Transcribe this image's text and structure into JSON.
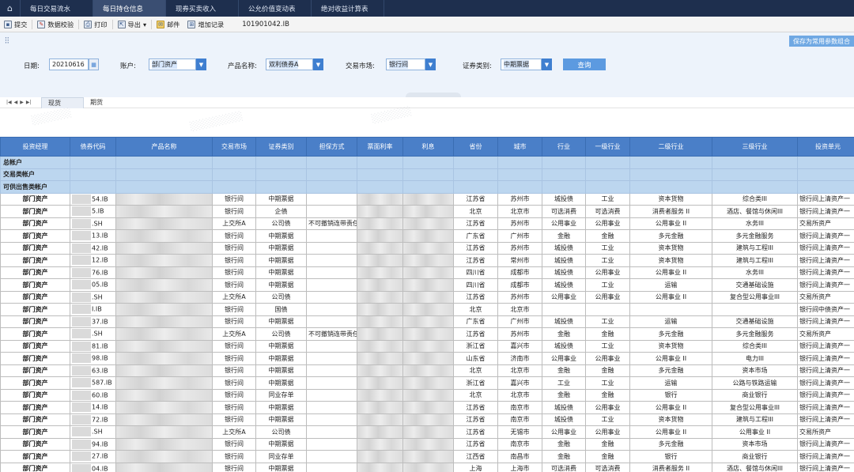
{
  "top_tabs": {
    "home_icon": "home-icon",
    "items": [
      {
        "label": "每日交易流水",
        "active": false
      },
      {
        "label": "每日持仓信息",
        "active": true
      },
      {
        "label": "现券买卖收入",
        "active": false
      },
      {
        "label": "公允价值变动表",
        "active": false
      },
      {
        "label": "绝对收益计算表",
        "active": false
      }
    ]
  },
  "toolbar": {
    "submit": "提交",
    "validate": "数据校验",
    "print": "打印",
    "export": "导出",
    "export_arrow": "▾",
    "mail": "邮件",
    "add_record": "增加记录",
    "code": "101901042.IB"
  },
  "filters": {
    "save_params": "保存为常用参数组合",
    "date_label": "日期:",
    "date_value": "20210616",
    "account_label": "账户:",
    "account_value": "部门资产",
    "product_label": "产品名称:",
    "product_value": "双利债券A",
    "market_label": "交易市场:",
    "market_value": "银行间",
    "category_label": "证券类别:",
    "category_value": "中期票据",
    "query": "查询"
  },
  "sheet_tabs": {
    "nav": [
      "|◀",
      "◀",
      "▶",
      "▶|"
    ],
    "items": [
      {
        "label": "现货",
        "active": true
      },
      {
        "label": "期货",
        "active": false
      }
    ]
  },
  "table": {
    "columns": [
      "投资经理",
      "债券代码",
      "产品名称",
      "交易市场",
      "证券类别",
      "担保方式",
      "票面利率",
      "利息",
      "省份",
      "城市",
      "行业",
      "一级行业",
      "二级行业",
      "三级行业",
      "投资单元"
    ],
    "groups": [
      "总帐户",
      "交易类帐户",
      "可供出售类帐户"
    ],
    "rows": [
      [
        "部门资产",
        "54.IB",
        "",
        "银行间",
        "中期票据",
        "",
        "",
        "",
        "江苏省",
        "苏州市",
        "城投债",
        "工业",
        "资本货物",
        "综合类III",
        "银行间上清资产一"
      ],
      [
        "部门资产",
        "5.IB",
        "",
        "银行间",
        "企债",
        "",
        "",
        "",
        "北京",
        "北京市",
        "可选消费",
        "可选消费",
        "消费者服务 II",
        "酒店、餐馆与休闲III",
        "银行间上清资产一"
      ],
      [
        "部门资产",
        ".SH",
        "",
        "上交所A",
        "公司债",
        "不可撤销连带责任担保",
        "",
        "",
        "江苏省",
        "苏州市",
        "公用事业",
        "公用事业",
        "公用事业 II",
        "水务III",
        "交易所资产"
      ],
      [
        "部门资产",
        "13.IB",
        "",
        "银行间",
        "中期票据",
        "",
        "",
        "",
        "广东省",
        "广州市",
        "金融",
        "金融",
        "多元金融",
        "多元金融服务",
        "银行间上清资产一"
      ],
      [
        "部门资产",
        "42.IB",
        "",
        "银行间",
        "中期票据",
        "",
        "",
        "",
        "江苏省",
        "苏州市",
        "城投债",
        "工业",
        "资本货物",
        "建筑与工程III",
        "银行间上清资产一"
      ],
      [
        "部门资产",
        "12.IB",
        "",
        "银行间",
        "中期票据",
        "",
        "",
        "",
        "江苏省",
        "常州市",
        "城投债",
        "工业",
        "资本货物",
        "建筑与工程III",
        "银行间上清资产一"
      ],
      [
        "部门资产",
        "76.IB",
        "",
        "银行间",
        "中期票据",
        "",
        "",
        "",
        "四川省",
        "成都市",
        "城投债",
        "公用事业",
        "公用事业 II",
        "水务III",
        "银行间上清资产一"
      ],
      [
        "部门资产",
        "05.IB",
        "",
        "银行间",
        "中期票据",
        "",
        "",
        "",
        "四川省",
        "成都市",
        "城投债",
        "工业",
        "运输",
        "交通基础设施",
        "银行间上清资产一"
      ],
      [
        "部门资产",
        ".SH",
        "",
        "上交所A",
        "公司债",
        "",
        "",
        "",
        "江苏省",
        "苏州市",
        "公用事业",
        "公用事业",
        "公用事业 II",
        "复合型公用事业III",
        "交易所资产"
      ],
      [
        "部门资产",
        "I.IB",
        "",
        "银行间",
        "国债",
        "",
        "",
        "",
        "北京",
        "北京市",
        "",
        "",
        "",
        "",
        "银行间中债资产一"
      ],
      [
        "部门资产",
        "37.IB",
        "",
        "银行间",
        "中期票据",
        "",
        "",
        "",
        "广东省",
        "广州市",
        "城投债",
        "工业",
        "运输",
        "交通基础设施",
        "银行间上清资产一"
      ],
      [
        "部门资产",
        ".SH",
        "",
        "上交所A",
        "公司债",
        "不可撤销连带责任担保",
        "",
        "",
        "江苏省",
        "苏州市",
        "金融",
        "金融",
        "多元金融",
        "多元金融服务",
        "交易所资产"
      ],
      [
        "部门资产",
        "81.IB",
        "",
        "银行间",
        "中期票据",
        "",
        "",
        "",
        "浙江省",
        "嘉兴市",
        "城投债",
        "工业",
        "资本货物",
        "综合类III",
        "银行间上清资产一"
      ],
      [
        "部门资产",
        "98.IB",
        "",
        "银行间",
        "中期票据",
        "",
        "",
        "",
        "山东省",
        "济南市",
        "公用事业",
        "公用事业",
        "公用事业 II",
        "电力III",
        "银行间上清资产一"
      ],
      [
        "部门资产",
        "63.IB",
        "",
        "银行间",
        "中期票据",
        "",
        "",
        "",
        "北京",
        "北京市",
        "金融",
        "金融",
        "多元金融",
        "资本市场",
        "银行间上清资产一"
      ],
      [
        "部门资产",
        "587.IB",
        "",
        "银行间",
        "中期票据",
        "",
        "",
        "",
        "浙江省",
        "嘉兴市",
        "工业",
        "工业",
        "运输",
        "公路与铁路运输",
        "银行间上清资产一"
      ],
      [
        "部门资产",
        "60.IB",
        "",
        "银行间",
        "同业存单",
        "",
        "",
        "",
        "北京",
        "北京市",
        "金融",
        "金融",
        "银行",
        "商业银行",
        "银行间上清资产一"
      ],
      [
        "部门资产",
        "14.IB",
        "",
        "银行间",
        "中期票据",
        "",
        "",
        "",
        "江苏省",
        "南京市",
        "城投债",
        "公用事业",
        "公用事业 II",
        "复合型公用事业III",
        "银行间上清资产一"
      ],
      [
        "部门资产",
        "72.IB",
        "",
        "银行间",
        "中期票据",
        "",
        "",
        "",
        "江苏省",
        "南京市",
        "城投债",
        "工业",
        "资本货物",
        "建筑与工程III",
        "银行间上清资产一"
      ],
      [
        "部门资产",
        ".SH",
        "",
        "上交所A",
        "公司债",
        "",
        "",
        "",
        "江苏省",
        "无锡市",
        "公用事业",
        "公用事业",
        "公用事业 II",
        "公用事业 II",
        "交易所资产"
      ],
      [
        "部门资产",
        "94.IB",
        "",
        "银行间",
        "中期票据",
        "",
        "",
        "",
        "江苏省",
        "南京市",
        "金融",
        "金融",
        "多元金融",
        "资本市场",
        "银行间上清资产一"
      ],
      [
        "部门资产",
        "27.IB",
        "",
        "银行间",
        "同业存单",
        "",
        "",
        "",
        "江西省",
        "南昌市",
        "金融",
        "金融",
        "银行",
        "商业银行",
        "银行间上清资产一"
      ],
      [
        "部门资产",
        "04.IB",
        "",
        "银行间",
        "中期票据",
        "",
        "",
        "",
        "上海",
        "上海市",
        "可选消费",
        "可选消费",
        "消费者服务 II",
        "酒店、餐馆与休闲III",
        "银行间上清资产一"
      ]
    ]
  }
}
